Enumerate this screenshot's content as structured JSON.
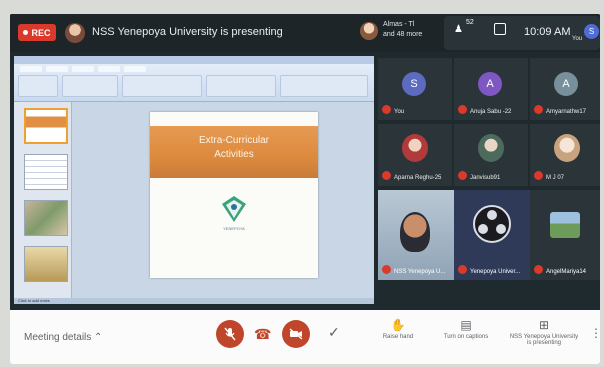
{
  "topbar": {
    "rec_label": "REC",
    "presenting_label": "NSS Yenepoya University is presenting",
    "participants_line1": "Almas - Tl",
    "participants_line2": "and 48 more",
    "people_count": "52",
    "clock": "10:09 AM",
    "self_label": "You",
    "self_initial": "S"
  },
  "presentation": {
    "slide_title_line1": "Extra-Curricular",
    "slide_title_line2": "Activities",
    "logo_caption": "YENEPOYA",
    "status_text": "Click to add notes"
  },
  "participants": [
    {
      "name": "You",
      "initial": "S",
      "color": "#5c6bc0"
    },
    {
      "name": "Anuja Sabu -22",
      "initial": "A",
      "color": "#7e57c2"
    },
    {
      "name": "Amyarnathw17",
      "initial": "A",
      "color": "#78909c"
    },
    {
      "name": "Aparna Reghu-25",
      "initial": "",
      "color": "#8d4a3a"
    },
    {
      "name": "Janvisub91",
      "initial": "",
      "color": "#556b5a"
    },
    {
      "name": "M J 07",
      "initial": "",
      "color": "#c9a27e"
    },
    {
      "name": "NSS Yenepoya U...",
      "initial": "",
      "color": ""
    },
    {
      "name": "Yenepoya Univer...",
      "initial": "",
      "color": ""
    },
    {
      "name": "AngelMariya14",
      "initial": "",
      "color": ""
    }
  ],
  "bottombar": {
    "meeting_details": "Meeting details",
    "raise_hand": "Raise hand",
    "captions": "Turn on captions",
    "presenting_line1": "NSS Yenepoya University",
    "presenting_line2": "is presenting"
  },
  "colors": {
    "accent_red": "#c0462b",
    "rec_red": "#d93a2b",
    "slide_orange": "#e08f44"
  }
}
